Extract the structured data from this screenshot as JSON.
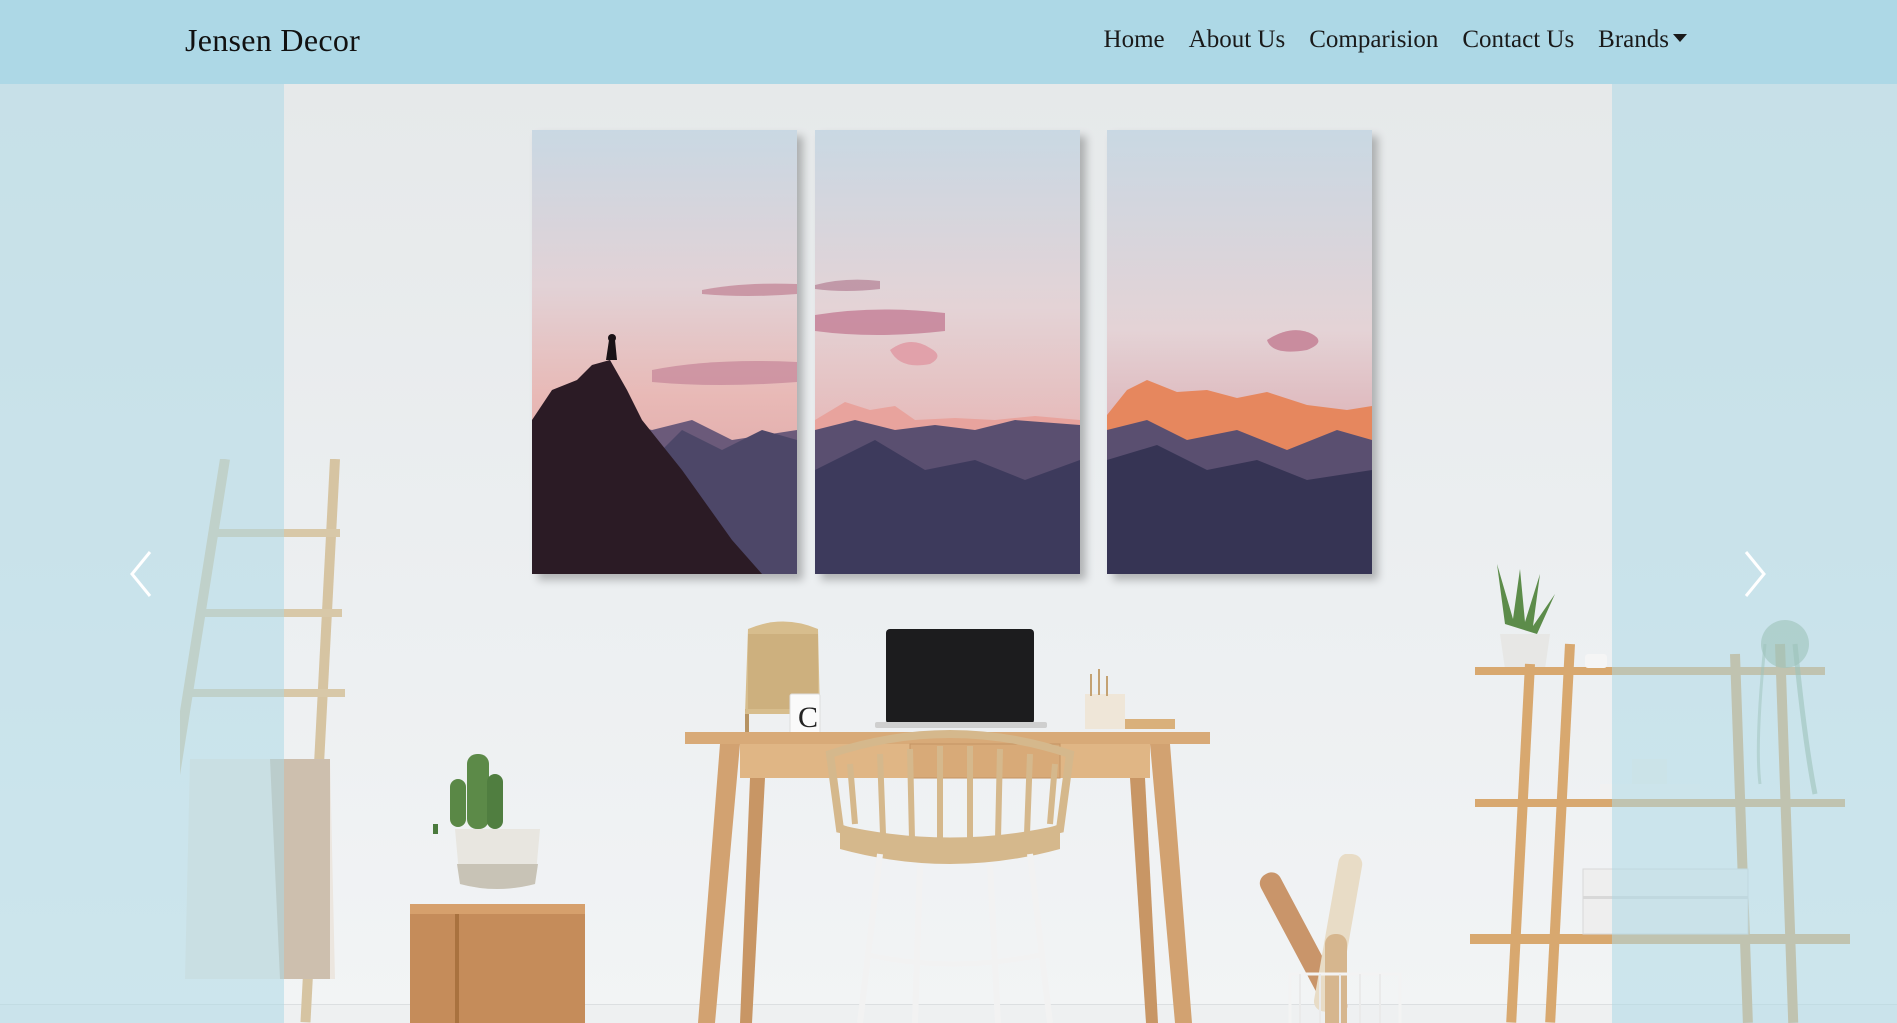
{
  "navbar": {
    "brand": "Jensen Decor",
    "items": [
      {
        "label": "Home"
      },
      {
        "label": "About Us"
      },
      {
        "label": "Comparision"
      },
      {
        "label": "Contact Us"
      },
      {
        "label": "Brands"
      }
    ]
  },
  "carousel": {
    "prev_icon": "chevron-left-icon",
    "next_icon": "chevron-right-icon",
    "slide_image": "mountain-triptych-office-scene",
    "mug_letter": "C"
  },
  "colors": {
    "navbar_bg": "#add8e6",
    "side_tint": "#add8e6"
  }
}
